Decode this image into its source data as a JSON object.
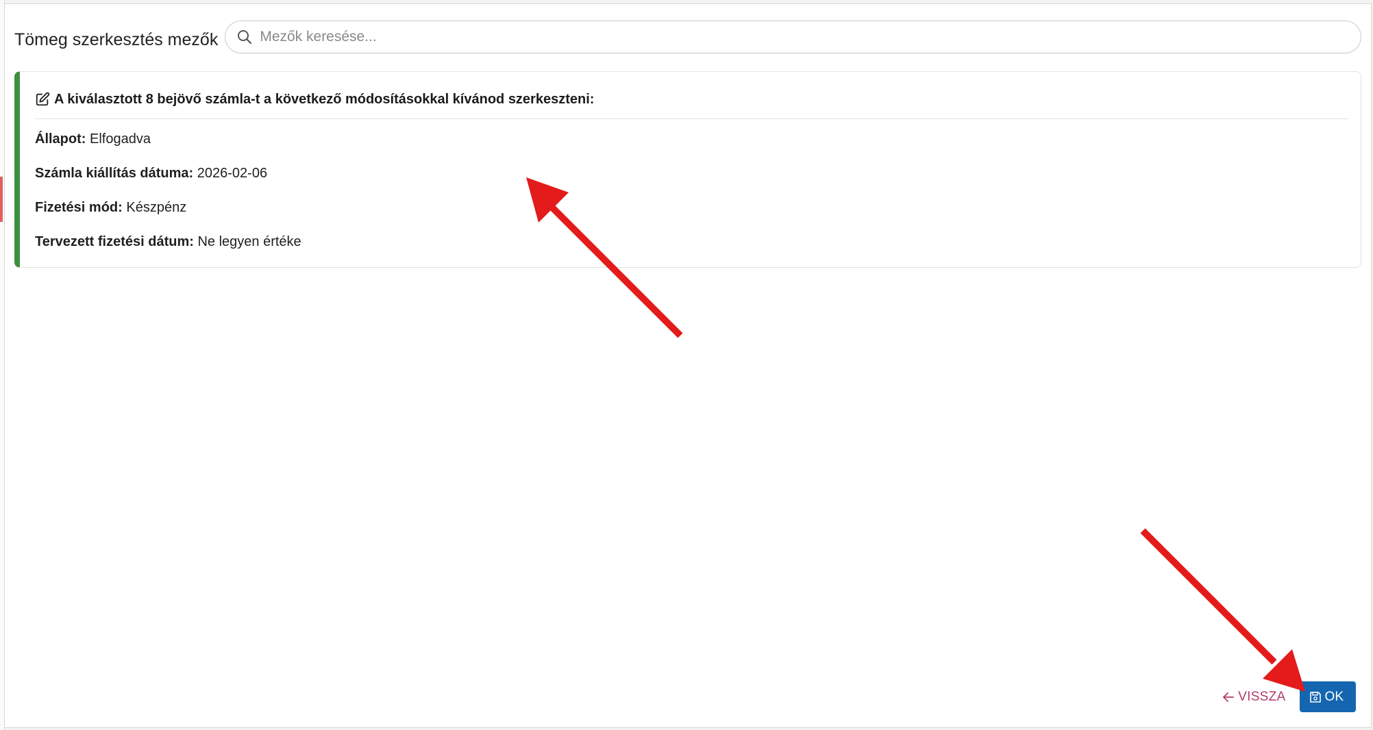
{
  "dialog": {
    "title": "Tömeg szerkesztés mezők",
    "search": {
      "placeholder": "Mezők keresése...",
      "value": ""
    }
  },
  "summary": {
    "heading": "A kiválasztott 8 bejövő számla-t a következő módosításokkal kívánod szerkeszteni:",
    "fields": [
      {
        "label": "Állapot:",
        "value": "Elfogadva"
      },
      {
        "label": "Számla kiállítás dátuma:",
        "value": "2026-02-06"
      },
      {
        "label": "Fizetési mód:",
        "value": "Készpénz"
      },
      {
        "label": "Tervezett fizetési dátum:",
        "value": "Ne legyen értéke"
      }
    ],
    "accent_color": "#3e8e41"
  },
  "footer": {
    "back_label": "VISSZA",
    "ok_label": "OK",
    "back_color": "#b23a6b",
    "ok_color": "#1466b0"
  },
  "annotations": {
    "arrow_color": "#e31b1b"
  }
}
